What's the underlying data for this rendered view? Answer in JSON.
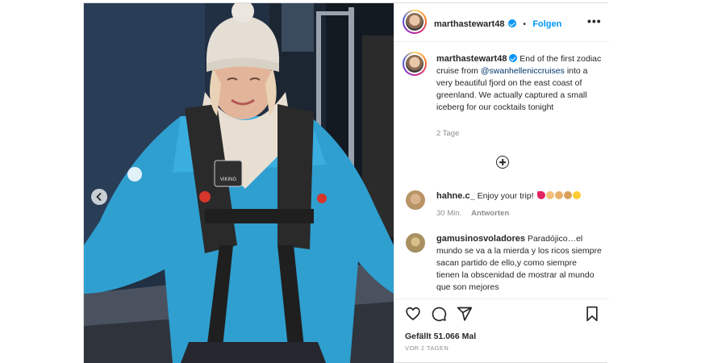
{
  "header": {
    "username": "marthastewart48",
    "separator": "•",
    "follow_label": "Folgen",
    "more_label": "•••"
  },
  "caption": {
    "username": "marthastewart48",
    "text_part1": "End of the first zodiac cruise from",
    "mention": "@swanhelleniccruises",
    "text_part2": "into a very beautiful fjord on the east coast of greenland. We actually captured a small iceberg for our cocktails tonight",
    "time_ago": "2 Tage"
  },
  "comments": [
    {
      "username": "hahne.c_",
      "text": "Enjoy your trip!",
      "emojis": [
        "heart",
        "clap",
        "clap",
        "clap",
        "star-struck"
      ],
      "time": "30 Min.",
      "reply_label": "Antworten"
    },
    {
      "username": "gamusinosvoladores",
      "text": "Paradójico…el mundo se va a la mierda y los ricos siempre sacan partido de ello,y como siempre tienen la obscenidad de mostrar al mundo que son mejores"
    }
  ],
  "footer": {
    "likes": "Gefällt 51.066 Mal",
    "date": "VOR 2 TAGEN"
  },
  "photo": {
    "jacket_label": "VIKING"
  },
  "colors": {
    "accent": "#0095f6",
    "jacket": "#2f9fd0",
    "hat": "#e4ded5",
    "background": "#1e2a3a"
  },
  "icons": [
    "chevron-left-icon",
    "verified-icon",
    "more-icon",
    "plus-circle-icon",
    "heart-icon",
    "comment-icon",
    "share-icon",
    "bookmark-icon"
  ]
}
